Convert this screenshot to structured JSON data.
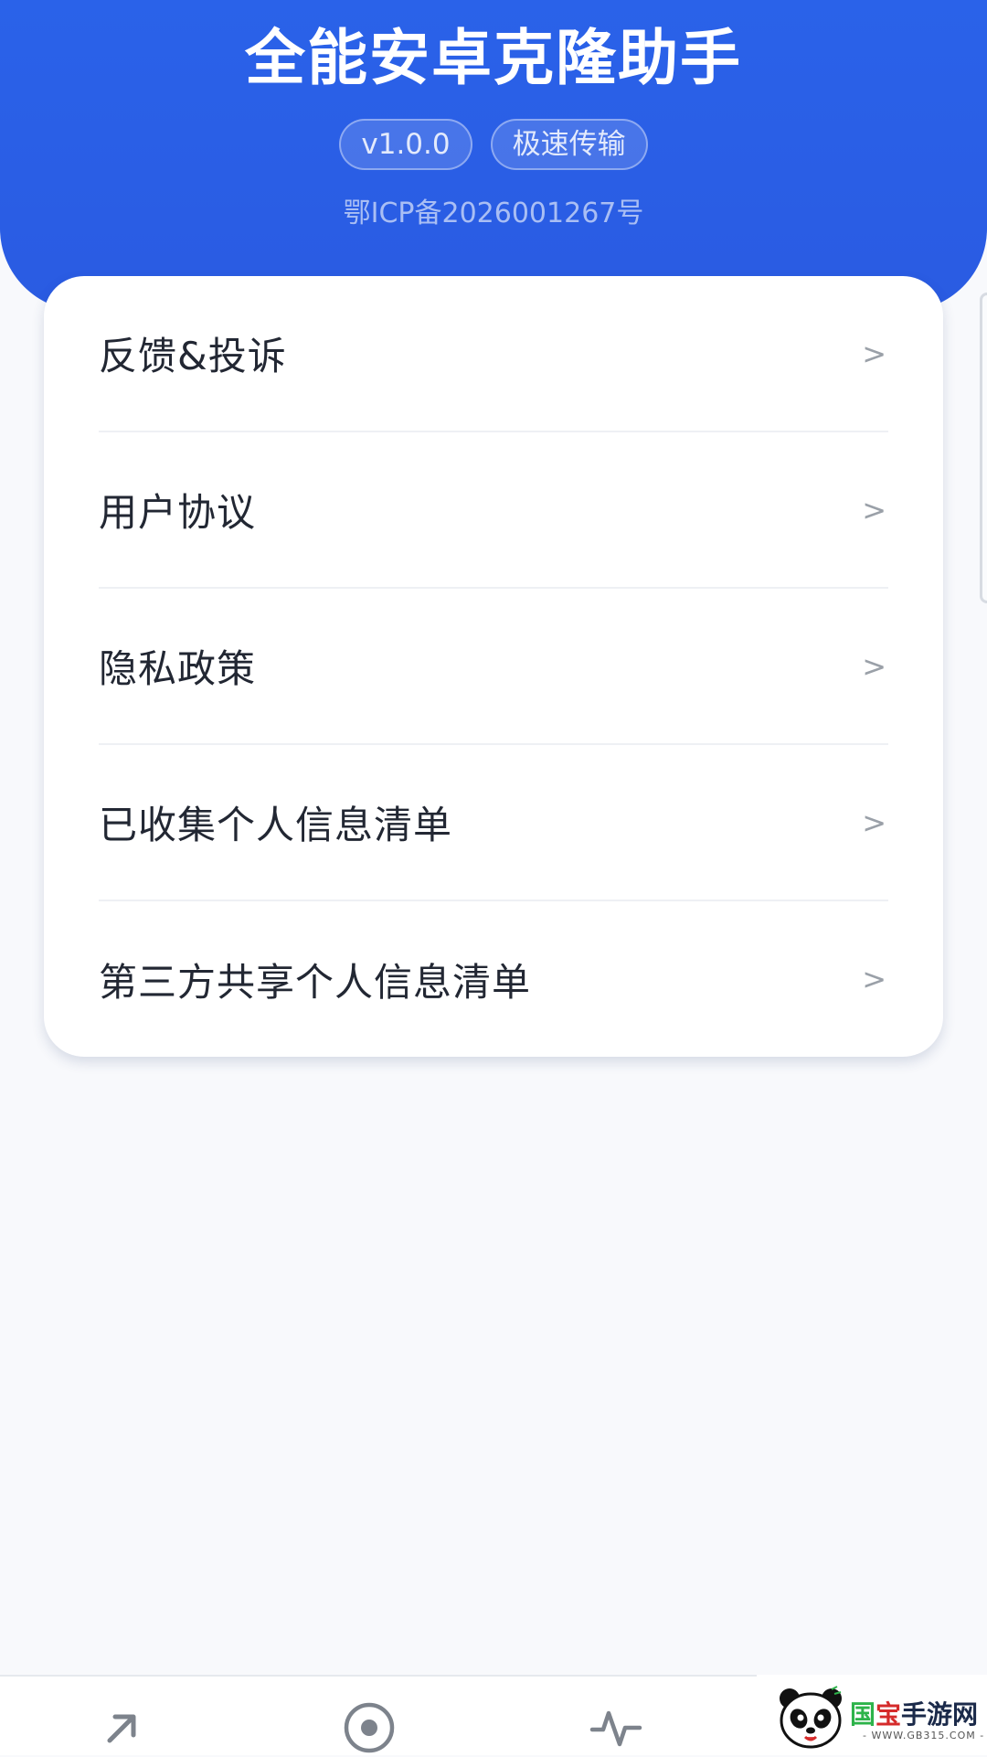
{
  "header": {
    "title": "全能安卓克隆助手",
    "tags": [
      "v1.0.0",
      "极速传输"
    ],
    "icp": "鄂ICP备2026001267号",
    "accent_color": "#2a5fe6"
  },
  "menu": {
    "items": [
      {
        "label": "反馈&投诉",
        "chevron": ">"
      },
      {
        "label": "用户协议",
        "chevron": ">"
      },
      {
        "label": "隐私政策",
        "chevron": ">"
      },
      {
        "label": "已收集个人信息清单",
        "chevron": ">"
      },
      {
        "label": "第三方共享个人信息清单",
        "chevron": ">"
      }
    ]
  },
  "bottom_nav": {
    "icons": [
      "arrow-up-right-icon",
      "target-circle-icon",
      "pulse-icon"
    ]
  },
  "watermark": {
    "brand_part1": "国",
    "brand_part2": "宝",
    "brand_part3": "手游网",
    "url": "- WWW.GB315.COM -"
  }
}
